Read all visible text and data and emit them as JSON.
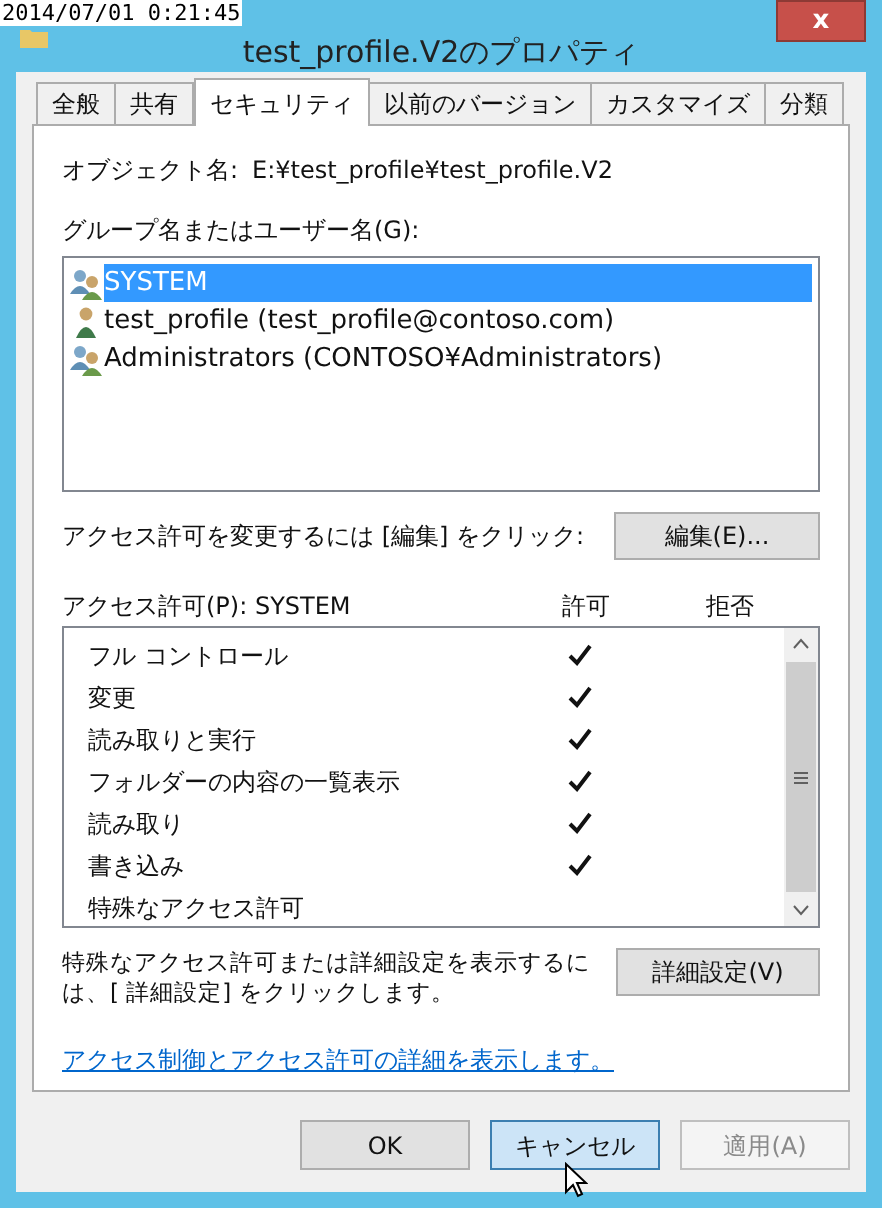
{
  "timestamp": "2014/07/01 0:21:45",
  "window": {
    "title": "test_profile.V2のプロパティ",
    "close": "x"
  },
  "tabs": [
    {
      "label": "全般",
      "selected": false
    },
    {
      "label": "共有",
      "selected": false
    },
    {
      "label": "セキュリティ",
      "selected": true
    },
    {
      "label": "以前のバージョン",
      "selected": false
    },
    {
      "label": "カスタマイズ",
      "selected": false
    },
    {
      "label": "分類",
      "selected": false
    }
  ],
  "object_name": {
    "label": "オブジェクト名:",
    "value": "E:¥test_profile¥test_profile.V2"
  },
  "users": {
    "label": "グループ名またはユーザー名(G):",
    "items": [
      {
        "kind": "group",
        "name": "SYSTEM",
        "selected": true
      },
      {
        "kind": "user",
        "name": "test_profile (test_profile@contoso.com)",
        "selected": false
      },
      {
        "kind": "group",
        "name": "Administrators (CONTOSO¥Administrators)",
        "selected": false
      }
    ]
  },
  "edit": {
    "text": "アクセス許可を変更するには [編集] をクリック:",
    "button": "編集(E)..."
  },
  "permissions": {
    "label": "アクセス許可(P): SYSTEM",
    "allow_header": "許可",
    "deny_header": "拒否",
    "rows": [
      {
        "name": "フル コントロール",
        "allow": true,
        "deny": false
      },
      {
        "name": "変更",
        "allow": true,
        "deny": false
      },
      {
        "name": "読み取りと実行",
        "allow": true,
        "deny": false
      },
      {
        "name": "フォルダーの内容の一覧表示",
        "allow": true,
        "deny": false
      },
      {
        "name": "読み取り",
        "allow": true,
        "deny": false
      },
      {
        "name": "書き込み",
        "allow": true,
        "deny": false
      },
      {
        "name": "特殊なアクセス許可",
        "allow": false,
        "deny": false
      }
    ]
  },
  "advanced": {
    "text": "特殊なアクセス許可または詳細設定を表示するには、[ 詳細設定] をクリックします。",
    "button": "詳細設定(V)"
  },
  "link": "アクセス制御とアクセス許可の詳細を表示します。",
  "buttons": [
    {
      "label": "OK",
      "hovered": false,
      "disabled": false
    },
    {
      "label": "キャンセル",
      "hovered": true,
      "disabled": false
    },
    {
      "label": "適用(A)",
      "hovered": false,
      "disabled": true
    }
  ]
}
